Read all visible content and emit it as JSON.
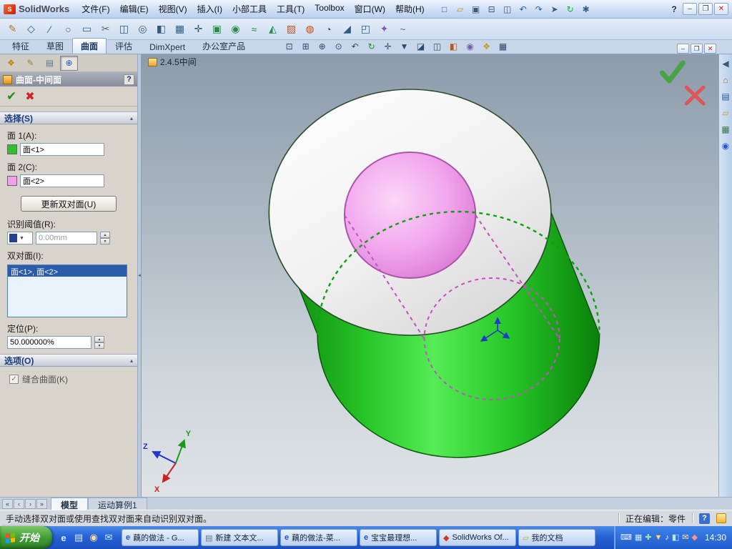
{
  "colors": {
    "selection_green": "#2fbf2f",
    "selection_pink": "#f2a0ee",
    "list_highlight": "#2a5caa",
    "taskbar_blue": "#2563d8",
    "start_green": "#3e9a34",
    "viewport_top": "#8d9bab",
    "viewport_bottom": "#dfe3e6"
  },
  "titlebar": {
    "app_name": "SolidWorks",
    "help_glyph": "?",
    "menus": [
      {
        "name": "menu-file",
        "label": "文件(F)"
      },
      {
        "name": "menu-edit",
        "label": "编辑(E)"
      },
      {
        "name": "menu-view",
        "label": "视图(V)"
      },
      {
        "name": "menu-insert",
        "label": "插入(I)"
      },
      {
        "name": "menu-widget-tools",
        "label": "小部工具"
      },
      {
        "name": "menu-tools",
        "label": "工具(T)"
      },
      {
        "name": "menu-toolbox",
        "label": "Toolbox"
      },
      {
        "name": "menu-window",
        "label": "窗口(W)"
      },
      {
        "name": "menu-help",
        "label": "帮助(H)"
      }
    ],
    "std_icons": [
      {
        "name": "new-document-icon",
        "glyph": "□",
        "color": "#3a5a82"
      },
      {
        "name": "open-icon",
        "glyph": "▱",
        "color": "#c89020"
      },
      {
        "name": "save-icon",
        "glyph": "▣",
        "color": "#3a5a82"
      },
      {
        "name": "print-icon",
        "glyph": "⊟",
        "color": "#3a5a82"
      },
      {
        "name": "print-preview-icon",
        "glyph": "◫",
        "color": "#3a5a82"
      },
      {
        "name": "undo-icon",
        "glyph": "↶",
        "color": "#2255cc"
      },
      {
        "name": "redo-icon",
        "glyph": "↷",
        "color": "#2255cc"
      },
      {
        "name": "select-icon",
        "glyph": "➤",
        "color": "#3a5a82"
      },
      {
        "name": "rebuild-icon",
        "glyph": "↻",
        "color": "#22aa44"
      },
      {
        "name": "options-icon",
        "glyph": "✱",
        "color": "#3a5a82"
      }
    ],
    "window_buttons": [
      {
        "name": "minimize-button",
        "glyph": "–"
      },
      {
        "name": "restore-button",
        "glyph": "❐"
      },
      {
        "name": "close-button",
        "glyph": "✕",
        "color": "#c22222"
      }
    ]
  },
  "toolbar2": {
    "icons": [
      {
        "name": "sketch-icon",
        "glyph": "✎",
        "color": "#b8762a"
      },
      {
        "name": "smart-dimension-icon",
        "glyph": "◇",
        "color": "#34597e"
      },
      {
        "name": "line-icon",
        "glyph": "∕",
        "color": "#34597e"
      },
      {
        "name": "circle-icon",
        "glyph": "○",
        "color": "#34597e"
      },
      {
        "name": "rectangle-icon",
        "glyph": "▭",
        "color": "#34597e"
      },
      {
        "name": "trim-entities-icon",
        "glyph": "✂",
        "color": "#666666"
      },
      {
        "name": "convert-entities-icon",
        "glyph": "◫",
        "color": "#34597e"
      },
      {
        "name": "offset-entities-icon",
        "glyph": "◎",
        "color": "#34597e"
      },
      {
        "name": "mirror-entities-icon",
        "glyph": "◧",
        "color": "#34597e"
      },
      {
        "name": "linear-pattern-icon",
        "glyph": "▦",
        "color": "#34597e"
      },
      {
        "name": "move-entities-icon",
        "glyph": "✛",
        "color": "#34597e"
      },
      {
        "name": "extruded-boss-icon",
        "glyph": "▣",
        "color": "#2a8a4a"
      },
      {
        "name": "revolved-boss-icon",
        "glyph": "◉",
        "color": "#2a8a4a"
      },
      {
        "name": "swept-boss-icon",
        "glyph": "≈",
        "color": "#2a8a4a"
      },
      {
        "name": "lofted-boss-icon",
        "glyph": "◭",
        "color": "#2a8a4a"
      },
      {
        "name": "extruded-cut-icon",
        "glyph": "▨",
        "color": "#b05a2a"
      },
      {
        "name": "hole-wizard-icon",
        "glyph": "◍",
        "color": "#b05a2a"
      },
      {
        "name": "fillet-icon",
        "glyph": "◔",
        "color": "#34597e"
      },
      {
        "name": "chamfer-icon",
        "glyph": "◢",
        "color": "#34597e"
      },
      {
        "name": "shell-icon",
        "glyph": "◰",
        "color": "#34597e"
      },
      {
        "name": "reference-geometry-icon",
        "glyph": "✦",
        "color": "#7a5ab0"
      },
      {
        "name": "curves-icon",
        "glyph": "~",
        "color": "#7a5ab0"
      }
    ]
  },
  "command_bar": {
    "tabs": [
      {
        "name": "tab-features",
        "label": "特征"
      },
      {
        "name": "tab-sketch",
        "label": "草图"
      },
      {
        "name": "tab-surfaces",
        "label": "曲面",
        "active": true
      },
      {
        "name": "tab-evaluate",
        "label": "评估"
      },
      {
        "name": "tab-dimxpert",
        "label": "DimXpert"
      },
      {
        "name": "tab-office-products",
        "label": "办公室产品"
      }
    ],
    "view_icons": [
      {
        "name": "zoom-to-fit-icon",
        "glyph": "⊡",
        "color": "#2c4a6e"
      },
      {
        "name": "zoom-to-area-icon",
        "glyph": "⊞",
        "color": "#2c4a6e"
      },
      {
        "name": "zoom-in-out-icon",
        "glyph": "⊕",
        "color": "#2c4a6e"
      },
      {
        "name": "zoom-to-selection-icon",
        "glyph": "⊙",
        "color": "#2c4a6e"
      },
      {
        "name": "previous-view-icon",
        "glyph": "↶",
        "color": "#2c4a6e"
      },
      {
        "name": "rotate-view-icon",
        "glyph": "↻",
        "color": "#2c8a3e"
      },
      {
        "name": "pan-icon",
        "glyph": "✛",
        "color": "#2c4a6e"
      },
      {
        "name": "view-orientation-icon",
        "glyph": "▼",
        "color": "#2c4a6e"
      },
      {
        "name": "display-style-icon",
        "glyph": "◪",
        "color": "#2c4a6e"
      },
      {
        "name": "hidden-lines-icon",
        "glyph": "◫",
        "color": "#2c4a6e"
      },
      {
        "name": "section-view-icon",
        "glyph": "◧",
        "color": "#b05a2a"
      },
      {
        "name": "view-settings-icon",
        "glyph": "◉",
        "color": "#7a5ab0"
      },
      {
        "name": "appearances-icon",
        "glyph": "❖",
        "color": "#c8991a"
      },
      {
        "name": "scene-icon",
        "glyph": "▦",
        "color": "#2c4a6e"
      }
    ],
    "window_buttons": [
      {
        "name": "doc-minimize-button",
        "glyph": "–"
      },
      {
        "name": "doc-restore-button",
        "glyph": "❐"
      },
      {
        "name": "doc-close-button",
        "glyph": "✕",
        "color": "#c22222"
      }
    ]
  },
  "doc_overlay": {
    "label": "2.4.5中间"
  },
  "pm": {
    "ok_glyph": "✔",
    "cancel_glyph": "✖",
    "tabs": [
      {
        "name": "featuremanager-tab-icon",
        "glyph": "❖",
        "color": "#b8860b"
      },
      {
        "name": "propertymanager-tab-icon",
        "glyph": "✎",
        "color": "#8a8a2a"
      },
      {
        "name": "configurationmanager-tab-icon",
        "glyph": "▤",
        "color": "#5a7a9a"
      },
      {
        "name": "active-command-tab-icon",
        "glyph": "⊕",
        "color": "#2255cc",
        "active": true
      }
    ],
    "header": {
      "title": "曲面-中间面",
      "help": "?"
    },
    "sections": {
      "selection": {
        "title": "选择(S)",
        "face1_label": "面 1(A):",
        "face1_value": "面<1>",
        "face2_label": "面 2(C):",
        "face2_value": "面<2>",
        "update_button": "更新双对面(U)",
        "threshold_label": "识别阈值(R):",
        "threshold_value": "0.00mm",
        "pairs_label": "双对面(I):",
        "pairs_selected": "面<1>, 面<2>",
        "position_label": "定位(P):",
        "position_value": "50.000000%"
      },
      "options": {
        "title": "选项(O)",
        "knit_label": "缝合曲面(K)",
        "knit_checked": true
      }
    }
  },
  "viewport": {
    "triad": {
      "x": "X",
      "y": "Y",
      "z": "Z"
    },
    "face1_color": "#2fbf2f",
    "face2_color": "#ee9aea"
  },
  "taskpane": {
    "icons": [
      {
        "name": "collapse-taskpane-icon",
        "glyph": "◀",
        "color": "#35597d"
      },
      {
        "name": "solidworks-resources-icon",
        "glyph": "⌂",
        "color": "#c06a1a"
      },
      {
        "name": "design-library-icon",
        "glyph": "▤",
        "color": "#2a5a9a"
      },
      {
        "name": "file-explorer-icon",
        "glyph": "▱",
        "color": "#c8991a"
      },
      {
        "name": "view-palette-icon",
        "glyph": "▦",
        "color": "#3a7a4a"
      },
      {
        "name": "appearances-pane-icon",
        "glyph": "◉",
        "color": "#2a5aca"
      }
    ]
  },
  "bottom_bar": {
    "nav": [
      {
        "name": "first-tab-button",
        "glyph": "«"
      },
      {
        "name": "prev-tab-button",
        "glyph": "‹"
      },
      {
        "name": "next-tab-button",
        "glyph": "›"
      },
      {
        "name": "last-tab-button",
        "glyph": "»"
      }
    ],
    "tabs": [
      {
        "name": "model-tab",
        "label": "模型",
        "active": true
      },
      {
        "name": "motion-study-tab",
        "label": "运动算例1"
      }
    ]
  },
  "statusbar": {
    "message": "手动选择双对面或使用查找双对面来自动识别双对面。",
    "editing": "正在编辑：零件",
    "help": "?"
  },
  "taskbar": {
    "start_label": "开始",
    "time": "14:30",
    "quick": [
      {
        "name": "internet-explorer-icon",
        "glyph": "e",
        "color": "#dff0ff"
      },
      {
        "name": "show-desktop-icon",
        "glyph": "▤",
        "color": "#d8e8ff"
      },
      {
        "name": "media-player-icon",
        "glyph": "◉",
        "color": "#ffd8a0"
      },
      {
        "name": "messenger-icon",
        "glyph": "✉",
        "color": "#c8f0e8"
      }
    ],
    "tasks": [
      {
        "name": "task-ou-recipe-google",
        "glyph": "e",
        "color": "#1a56c8",
        "label": "藕的做法 - G..."
      },
      {
        "name": "task-new-text-document",
        "glyph": "▤",
        "color": "#667788",
        "label": "新建 文本文..."
      },
      {
        "name": "task-ou-recipe-page",
        "glyph": "e",
        "color": "#1a56c8",
        "label": "藕的做法-菜..."
      },
      {
        "name": "task-baobao-page",
        "glyph": "e",
        "color": "#1a56c8",
        "label": "宝宝最理想..."
      },
      {
        "name": "task-solidworks-office",
        "glyph": "◆",
        "color": "#d03a1a",
        "label": "SolidWorks Of..."
      },
      {
        "name": "task-my-documents",
        "glyph": "▱",
        "color": "#d8a020",
        "label": "我的文档"
      }
    ],
    "tray": [
      {
        "name": "language-bar-icon",
        "glyph": "⌨",
        "color": "#e8f0ff"
      },
      {
        "name": "ime-icon",
        "glyph": "▦",
        "color": "#d8e8ff"
      },
      {
        "name": "antivirus-icon",
        "glyph": "✚",
        "color": "#9fe89f"
      },
      {
        "name": "download-icon",
        "glyph": "▼",
        "color": "#ffd868"
      },
      {
        "name": "volume-icon",
        "glyph": "♪",
        "color": "#ffffff"
      },
      {
        "name": "network-icon",
        "glyph": "◧",
        "color": "#bfe8ff"
      },
      {
        "name": "messenger-tray-icon",
        "glyph": "✉",
        "color": "#ffe8a0"
      },
      {
        "name": "security-icon",
        "glyph": "◆",
        "color": "#ff9090"
      }
    ]
  }
}
